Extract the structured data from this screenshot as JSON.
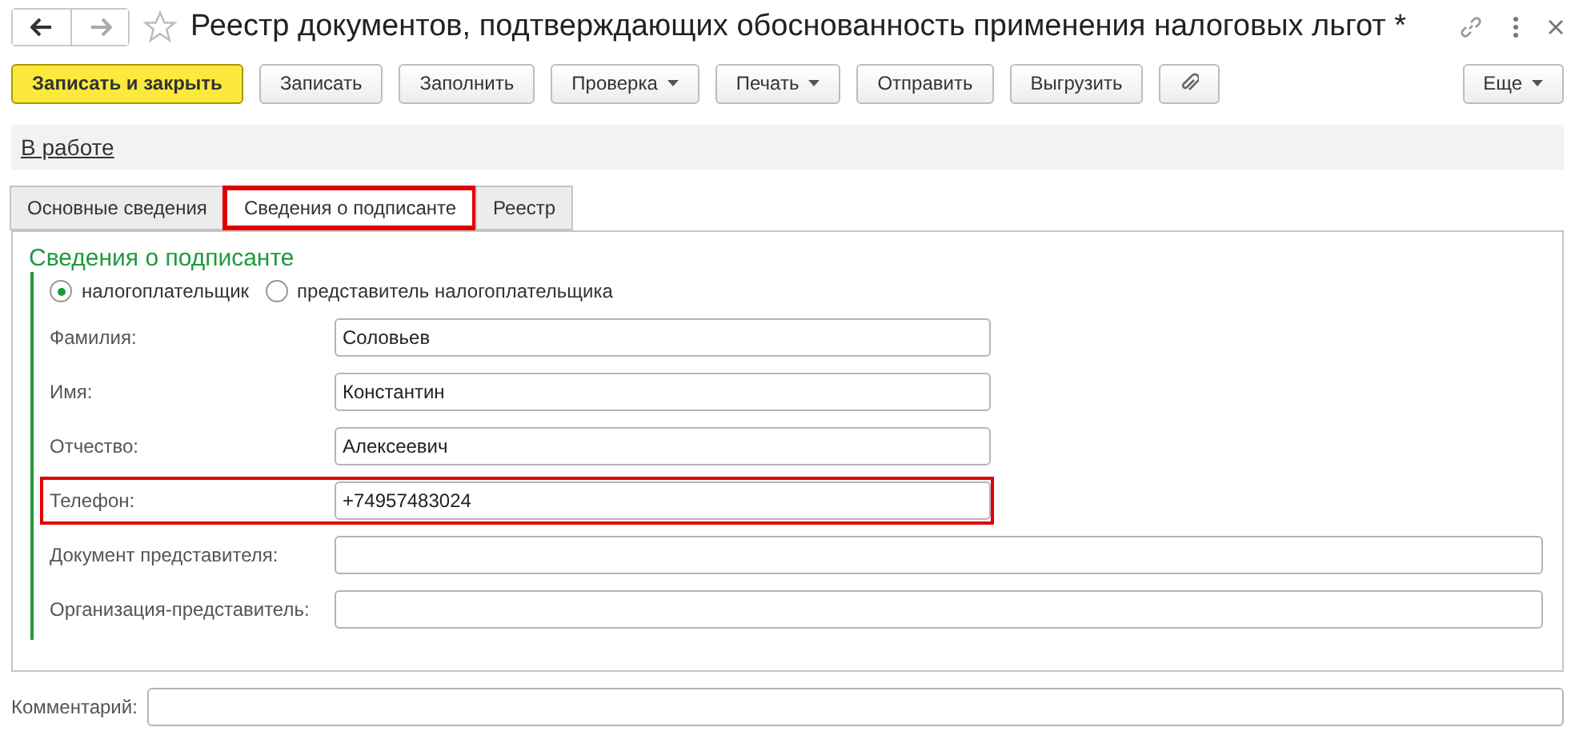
{
  "window": {
    "title": "Реестр документов, подтверждающих обоснованность применения налоговых льгот *"
  },
  "toolbar": [
    {
      "kind": "primary",
      "label": "Записать и закрыть"
    },
    {
      "kind": "plain",
      "label": "Записать"
    },
    {
      "kind": "plain",
      "label": "Заполнить"
    },
    {
      "kind": "dropdown",
      "label": "Проверка"
    },
    {
      "kind": "dropdown",
      "label": "Печать"
    },
    {
      "kind": "plain",
      "label": "Отправить"
    },
    {
      "kind": "plain",
      "label": "Выгрузить"
    },
    {
      "kind": "attach"
    }
  ],
  "more_button": "Еще",
  "status_link": "В работе",
  "tabs": [
    {
      "label": "Основные сведения",
      "selected": false,
      "highlighted": false
    },
    {
      "label": "Сведения о подписанте",
      "selected": true,
      "highlighted": true
    },
    {
      "label": "Реестр",
      "selected": false,
      "highlighted": false
    }
  ],
  "section_title": "Сведения о подписанте",
  "signer_options": [
    {
      "label": "налогоплательщик",
      "selected": true
    },
    {
      "label": "представитель налогоплательщика",
      "selected": false
    }
  ],
  "fields": [
    {
      "label": "Фамилия:",
      "value": "Соловьев",
      "kind": "short",
      "highlighted": false
    },
    {
      "label": "Имя:",
      "value": "Константин",
      "kind": "short",
      "highlighted": false
    },
    {
      "label": "Отчество:",
      "value": "Алексеевич",
      "kind": "short",
      "highlighted": false
    },
    {
      "label": "Телефон:",
      "value": "+74957483024",
      "kind": "short",
      "highlighted": true
    },
    {
      "label": "Документ представителя:",
      "kind": "wide",
      "highlighted": false
    },
    {
      "label": "Организация-представитель:",
      "kind": "wide",
      "highlighted": false
    }
  ],
  "comment": {
    "label": "Комментарий:"
  }
}
